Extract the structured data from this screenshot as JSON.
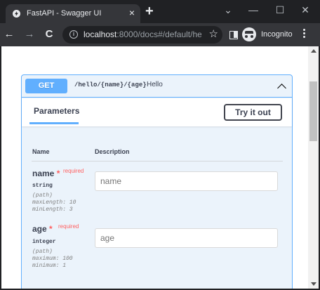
{
  "browser": {
    "tab_title": "FastAPI - Swagger UI",
    "tab_close": "×",
    "new_tab": "+",
    "url_host": "localhost",
    "url_rest": ":8000/docs#/default/hell...",
    "profile_label": "Incognito",
    "window_controls": {
      "minimize": "—",
      "maximize": "☐",
      "close": "✕",
      "tab_search": "⌄"
    },
    "nav": {
      "back": "←",
      "forward": "→",
      "reload": "C"
    }
  },
  "operation": {
    "method": "GET",
    "path": "/hello/{name}/{age}",
    "summary": "Hello",
    "parameters_title": "Parameters",
    "try_button": "Try it out",
    "columns": {
      "name": "Name",
      "description": "Description"
    },
    "params": [
      {
        "name": "name",
        "star": "*",
        "required": "required",
        "type": "string",
        "location": "(path)",
        "constraints": [
          "maxLength: 10",
          "minLength: 3"
        ],
        "placeholder": "name"
      },
      {
        "name": "age",
        "star": "*",
        "required": "required",
        "type": "integer",
        "location": "(path)",
        "constraints": [
          "maximum: 100",
          "minimum: 1"
        ],
        "placeholder": "age"
      }
    ]
  },
  "colors": {
    "get_accent": "#61affe",
    "opblock_bg": "#ebf3fb",
    "required_red": "#ff6060",
    "text_dark": "#3b4151"
  }
}
